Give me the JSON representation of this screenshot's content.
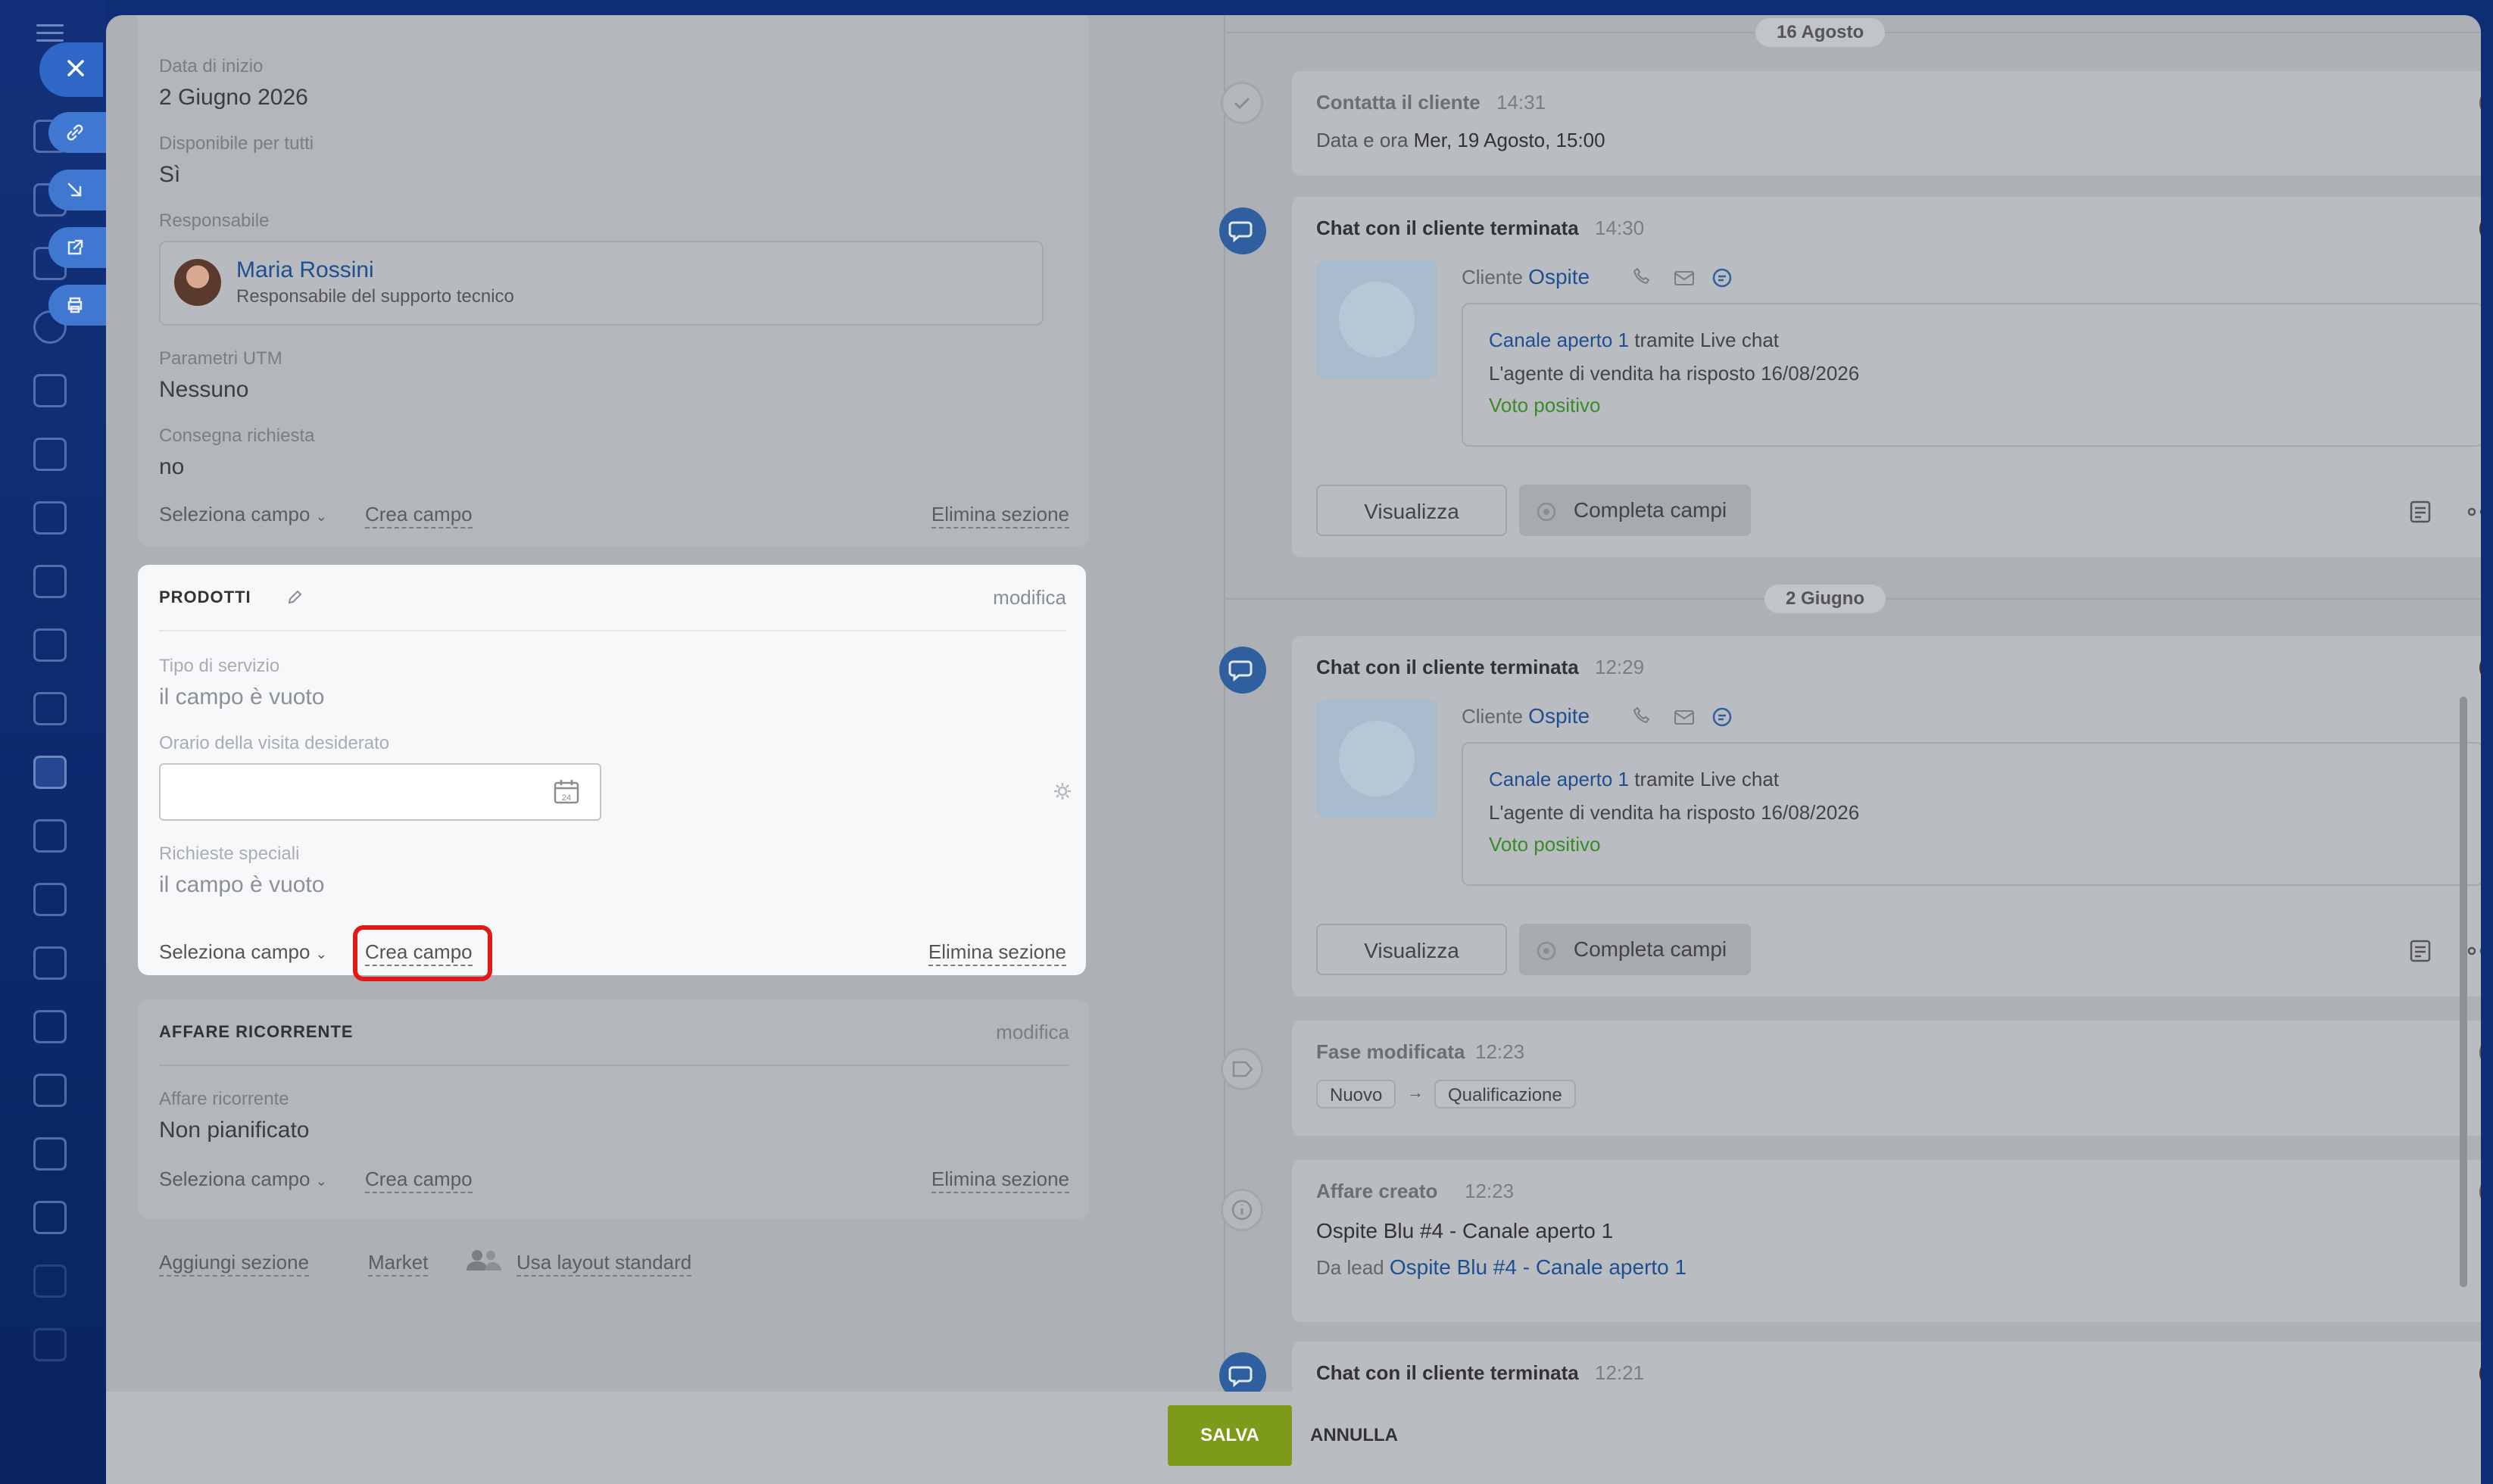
{
  "left_form": {
    "start_date": {
      "label": "Data di inizio",
      "value": "2 Giugno 2026"
    },
    "available": {
      "label": "Disponibile per tutti",
      "value": "Sì"
    },
    "responsible": {
      "label": "Responsabile",
      "name": "Maria Rossini",
      "role": "Responsabile del supporto tecnico"
    },
    "utm": {
      "label": "Parametri UTM",
      "value": "Nessuno"
    },
    "delivery": {
      "label": "Consegna richiesta",
      "value": "no"
    },
    "footer": {
      "select_field": "Seleziona campo",
      "create_field": "Crea campo",
      "delete_section": "Elimina sezione"
    }
  },
  "products": {
    "title": "PRODOTTI",
    "edit": "modifica",
    "service_type": {
      "label": "Tipo di servizio",
      "value": "il campo è vuoto"
    },
    "visit_time": {
      "label": "Orario della visita desiderato",
      "value": "",
      "calendar_day": "24"
    },
    "special_requests": {
      "label": "Richieste speciali",
      "value": "il campo è vuoto"
    },
    "footer": {
      "select_field": "Seleziona campo",
      "create_field": "Crea campo",
      "delete_section": "Elimina sezione"
    }
  },
  "recurring": {
    "title": "AFFARE RICORRENTE",
    "edit": "modifica",
    "field": {
      "label": "Affare ricorrente",
      "value": "Non pianificato"
    },
    "footer": {
      "select_field": "Seleziona campo",
      "create_field": "Crea campo",
      "delete_section": "Elimina sezione"
    }
  },
  "bottom_links": {
    "add_section": "Aggiungi sezione",
    "market": "Market",
    "standard_layout": "Usa layout standard"
  },
  "timeline": {
    "date_aug": "16 Agosto",
    "date_jun": "2 Giugno",
    "contact": {
      "title": "Contatta il cliente",
      "time": "14:31",
      "label": "Data e ora",
      "value": "Mer, 19 Agosto, 15:00"
    },
    "chat1": {
      "title": "Chat con il cliente terminata",
      "time": "14:30",
      "client_label": "Cliente",
      "client": "Ospite",
      "channel_link": "Canale aperto 1",
      "channel_rest": "tramite Live chat",
      "reply": "L'agente di vendita ha risposto 16/08/2026",
      "rating": "Voto positivo",
      "view": "Visualizza",
      "complete": "Completa campi"
    },
    "chat2": {
      "title": "Chat con il cliente terminata",
      "time": "12:29",
      "client_label": "Cliente",
      "client": "Ospite",
      "channel_link": "Canale aperto 1",
      "channel_rest": "tramite Live chat",
      "reply": "L'agente di vendita ha risposto 16/08/2026",
      "rating": "Voto positivo",
      "view": "Visualizza",
      "complete": "Completa campi"
    },
    "stage": {
      "title": "Fase modificata",
      "time": "12:23",
      "from": "Nuovo",
      "arrow": "→",
      "to": "Qualificazione"
    },
    "created": {
      "title": "Affare creato",
      "time": "12:23",
      "name": "Ospite Blu #4 - Canale aperto 1",
      "from_label": "Da lead",
      "from_link": "Ospite Blu #4 - Canale aperto 1"
    },
    "chat3": {
      "title": "Chat con il cliente terminata",
      "time": "12:21"
    }
  },
  "actions": {
    "save": "SALVA",
    "cancel": "ANNULLA"
  },
  "colors": {
    "save": "#7e9a1a",
    "highlight": "#e0191a",
    "link": "#1f4f8f",
    "positive": "#3a8a2a"
  }
}
